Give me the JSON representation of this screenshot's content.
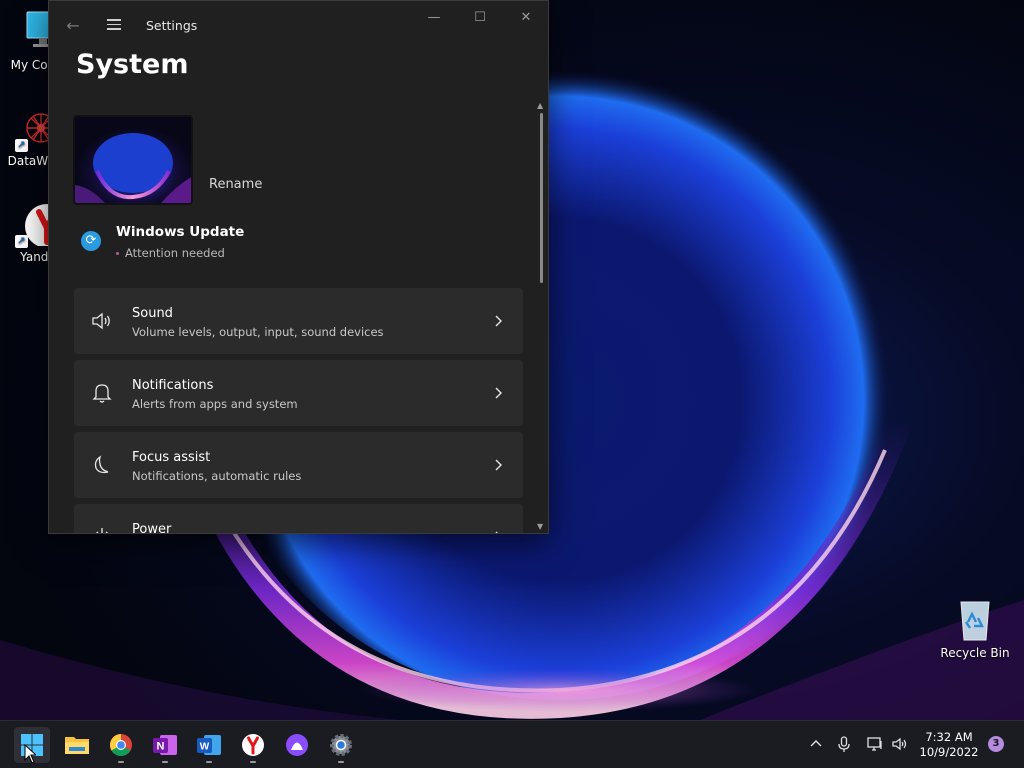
{
  "desktop": {
    "icons": [
      {
        "label": "My Com",
        "icon": "computer-icon"
      },
      {
        "label": "DataWag",
        "icon": "datawag-app-icon"
      },
      {
        "label": "Yande",
        "icon": "yandex-browser-icon"
      },
      {
        "label": "Recycle Bin",
        "icon": "recycle-bin-icon"
      }
    ]
  },
  "window": {
    "title": "Settings",
    "page_title": "System",
    "rename_label": "Rename",
    "windows_update": {
      "title": "Windows Update",
      "status": "Attention needed"
    },
    "cards": [
      {
        "title": "Sound",
        "subtitle": "Volume levels, output, input, sound devices",
        "icon": "speaker-icon"
      },
      {
        "title": "Notifications",
        "subtitle": "Alerts from apps and system",
        "icon": "bell-icon"
      },
      {
        "title": "Focus assist",
        "subtitle": "Notifications, automatic rules",
        "icon": "moon-icon"
      },
      {
        "title": "Power",
        "subtitle": "",
        "icon": "power-icon"
      }
    ]
  },
  "taskbar": {
    "apps": [
      {
        "name": "Start",
        "icon": "windows-start-icon"
      },
      {
        "name": "File Explorer",
        "icon": "folder-icon"
      },
      {
        "name": "Google Chrome",
        "icon": "chrome-icon"
      },
      {
        "name": "OneNote",
        "icon": "onenote-icon"
      },
      {
        "name": "Word",
        "icon": "word-icon"
      },
      {
        "name": "Yandex",
        "icon": "yandex-icon"
      },
      {
        "name": "Alice",
        "icon": "alice-icon"
      },
      {
        "name": "Settings",
        "icon": "settings-gear-icon"
      }
    ],
    "time": "7:32 AM",
    "date": "10/9/2022",
    "notification_count": "3"
  },
  "colors": {
    "window_bg": "#202020",
    "card_bg": "#2b2b2b",
    "accent_blue": "#2b9be0",
    "taskbar_bg": "#1b1c22",
    "badge": "#b58adf"
  }
}
